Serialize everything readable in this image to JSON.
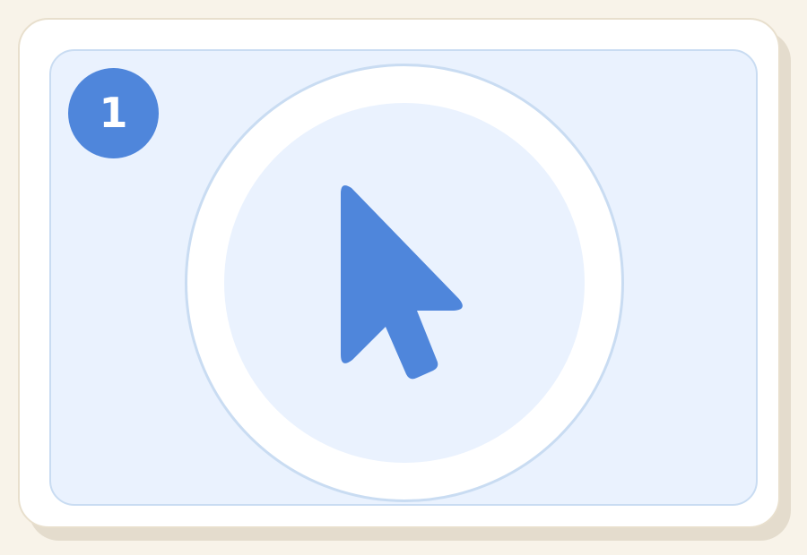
{
  "step_badge": {
    "number": "1"
  },
  "target": {
    "icon": "mouse-pointer-icon"
  },
  "colors": {
    "background": "#f8f3e9",
    "card": "#ffffff",
    "panel": "#eaf2fe",
    "accent": "#4f86db",
    "panel_border": "#c9dcf2"
  }
}
